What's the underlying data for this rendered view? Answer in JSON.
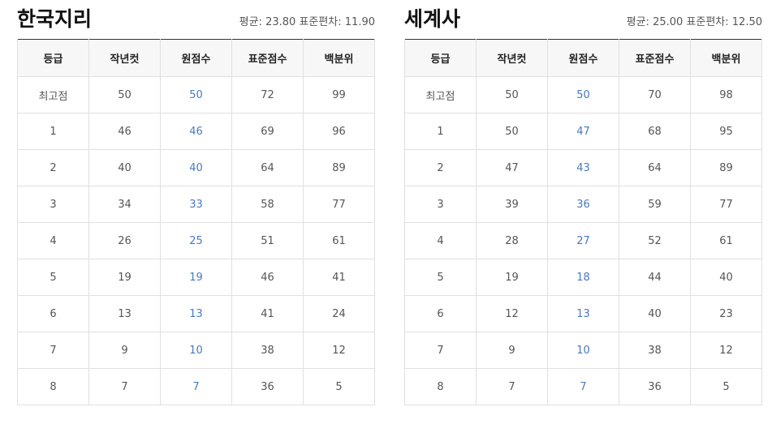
{
  "columns": [
    "등급",
    "작년컷",
    "원점수",
    "표준점수",
    "백분위"
  ],
  "panels": [
    {
      "title": "한국지리",
      "stats": "평균: 23.80 표준편차: 11.90",
      "rows": [
        [
          "최고점",
          "50",
          "50",
          "72",
          "99"
        ],
        [
          "1",
          "46",
          "46",
          "69",
          "96"
        ],
        [
          "2",
          "40",
          "40",
          "64",
          "89"
        ],
        [
          "3",
          "34",
          "33",
          "58",
          "77"
        ],
        [
          "4",
          "26",
          "25",
          "51",
          "61"
        ],
        [
          "5",
          "19",
          "19",
          "46",
          "41"
        ],
        [
          "6",
          "13",
          "13",
          "41",
          "24"
        ],
        [
          "7",
          "9",
          "10",
          "38",
          "12"
        ],
        [
          "8",
          "7",
          "7",
          "36",
          "5"
        ]
      ]
    },
    {
      "title": "세계사",
      "stats": "평균: 25.00 표준편차: 12.50",
      "rows": [
        [
          "최고점",
          "50",
          "50",
          "70",
          "98"
        ],
        [
          "1",
          "50",
          "47",
          "68",
          "95"
        ],
        [
          "2",
          "47",
          "43",
          "64",
          "89"
        ],
        [
          "3",
          "39",
          "36",
          "59",
          "77"
        ],
        [
          "4",
          "28",
          "27",
          "52",
          "61"
        ],
        [
          "5",
          "19",
          "18",
          "44",
          "40"
        ],
        [
          "6",
          "12",
          "13",
          "40",
          "23"
        ],
        [
          "7",
          "9",
          "10",
          "38",
          "12"
        ],
        [
          "8",
          "7",
          "7",
          "36",
          "5"
        ]
      ]
    }
  ],
  "colors": {
    "raw_score": "#4a78c2",
    "header_bg": "#f7f7f7",
    "border": "#e0e0e0"
  }
}
